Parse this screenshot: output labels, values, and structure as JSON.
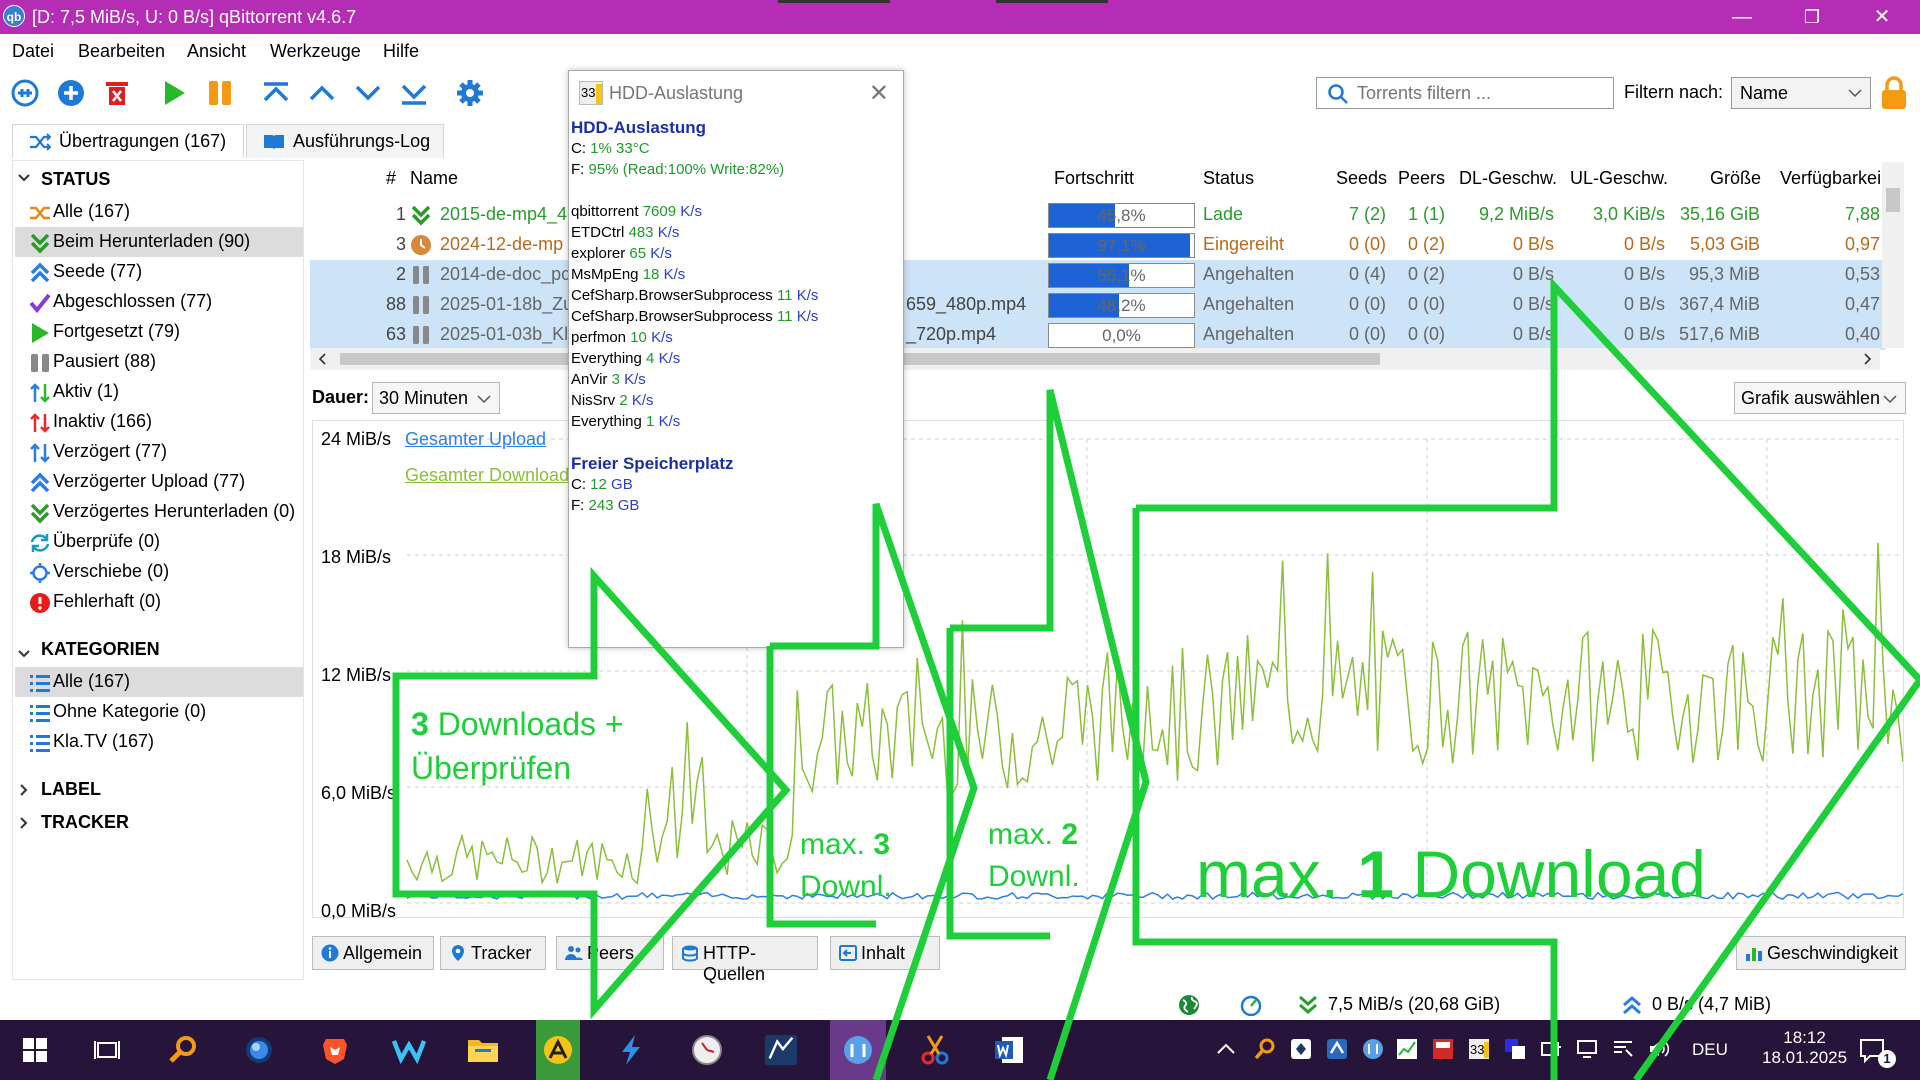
{
  "window": {
    "title": "[D: 7,5 MiB/s, U: 0 B/s] qBittorrent v4.6.7",
    "app_icon": "qb",
    "minimize": "—",
    "maximize": "❐",
    "close": "✕"
  },
  "menu": [
    "Datei",
    "Bearbeiten",
    "Ansicht",
    "Werkzeuge",
    "Hilfe"
  ],
  "toolbar": {
    "search_placeholder": "Torrents filtern ...",
    "filter_label": "Filtern nach:",
    "filter_value": "Name"
  },
  "tabs": [
    {
      "label": "Übertragungen (167)"
    },
    {
      "label": "Ausführungs-Log"
    }
  ],
  "sidebar": {
    "status_title": "STATUS",
    "status_items": [
      {
        "label": "Alle (167)",
        "color": "#e8861a"
      },
      {
        "label": "Beim Herunterladen (90)",
        "color": "#2a9a2a"
      },
      {
        "label": "Seede (77)",
        "color": "#2a7de8"
      },
      {
        "label": "Abgeschlossen (77)",
        "color": "#8a3ad6"
      },
      {
        "label": "Fortgesetzt (79)",
        "color": "#2ab82a"
      },
      {
        "label": "Pausiert (88)",
        "color": "#888888"
      },
      {
        "label": "Aktiv (1)",
        "color": "#2a7de8"
      },
      {
        "label": "Inaktiv (166)",
        "color": "#e82a2a"
      },
      {
        "label": "Verzögert (77)",
        "color": "#2a7de8"
      },
      {
        "label": "Verzögerter Upload (77)",
        "color": "#2a7de8"
      },
      {
        "label": "Verzögertes Herunterladen (0)",
        "color": "#2a9a2a"
      },
      {
        "label": "Überprüfe (0)",
        "color": "#1a9ac0"
      },
      {
        "label": "Verschiebe (0)",
        "color": "#2a7de8"
      },
      {
        "label": "Fehlerhaft (0)",
        "color": "#e82a2a"
      }
    ],
    "categories_title": "KATEGORIEN",
    "category_items": [
      {
        "label": "Alle (167)"
      },
      {
        "label": "Ohne Kategorie (0)"
      },
      {
        "label": "Kla.TV (167)"
      }
    ],
    "label_title": "LABEL",
    "tracker_title": "TRACKER"
  },
  "table": {
    "headers": {
      "num": "#",
      "name": "Name",
      "progress": "Fortschritt",
      "status": "Status",
      "seeds": "Seeds",
      "peers": "Peers",
      "dl": "DL-Geschw.",
      "ul": "UL-Geschw.",
      "size": "Größe",
      "avail": "Verfügbarkei"
    },
    "rows": [
      {
        "num": "1",
        "name": "2015-de-mp4_4",
        "name_tail": "",
        "progress": "45,8%",
        "progress_value": 0.458,
        "status": "Lade",
        "seeds": "7 (2)",
        "peers": "1 (1)",
        "dl": "9,2 MiB/s",
        "ul": "3,0 KiB/s",
        "size": "35,16 GiB",
        "avail": "7,88",
        "icon": "download"
      },
      {
        "num": "3",
        "name": "2024-12-de-mp",
        "name_tail": "",
        "progress": "97,1%",
        "progress_value": 0.971,
        "status": "Eingereiht",
        "seeds": "0 (0)",
        "peers": "0 (2)",
        "dl": "0 B/s",
        "ul": "0 B/s",
        "size": "5,03 GiB",
        "avail": "0,97",
        "icon": "queued"
      },
      {
        "num": "2",
        "name": "2014-de-doc_pc",
        "name_tail": "",
        "progress": "55,1%",
        "progress_value": 0.551,
        "status": "Angehalten",
        "seeds": "0 (4)",
        "peers": "0 (2)",
        "dl": "0 B/s",
        "ul": "0 B/s",
        "size": "95,3 MiB",
        "avail": "0,53",
        "icon": "paused"
      },
      {
        "num": "88",
        "name": "2025-01-18b_Zu",
        "name_tail": "659_480p.mp4",
        "progress": "48,2%",
        "progress_value": 0.482,
        "status": "Angehalten",
        "seeds": "0 (0)",
        "peers": "0 (0)",
        "dl": "0 B/s",
        "ul": "0 B/s",
        "size": "367,4 MiB",
        "avail": "0,47",
        "icon": "paused"
      },
      {
        "num": "63",
        "name": "2025-01-03b_Kl",
        "name_tail": "_720p.mp4",
        "progress": "0,0%",
        "progress_value": 0.0,
        "status": "Angehalten",
        "seeds": "0 (0)",
        "peers": "0 (0)",
        "dl": "0 B/s",
        "ul": "0 B/s",
        "size": "517,6 MiB",
        "avail": "0,40",
        "icon": "paused"
      }
    ]
  },
  "graph_controls": {
    "dauer_label": "Dauer:",
    "dauer_value": "30 Minuten",
    "grafik_value": "Grafik auswählen"
  },
  "graph": {
    "y_labels": [
      "24 MiB/s",
      "18 MiB/s",
      "12 MiB/s",
      "6,0 MiB/s",
      "0,0 MiB/s"
    ],
    "legend_upload": "Gesamter Upload",
    "legend_download": "Gesamter Download",
    "upload_color": "#2a80e8",
    "download_color": "#8cbf3a"
  },
  "bottom_tabs": [
    "Allgemein",
    "Tracker",
    "Peers",
    "HTTP-Quellen",
    "Inhalt",
    "Geschwindigkeit"
  ],
  "statusbar": {
    "download": "7,5 MiB/s (20,68 GiB)",
    "upload": "0 B/s (4,7 MiB)"
  },
  "taskbar": {
    "lang": "DEU",
    "time": "18:12",
    "date": "18.01.2025",
    "notification": "1"
  },
  "popup": {
    "title": "HDD-Auslastung",
    "icon_text": "33",
    "head1": "HDD-Auslastung",
    "c_label": "C:",
    "c_value": "1% 33°C",
    "f_label": "F:",
    "f_value": "95% (Read:100% Write:82%)",
    "processes": [
      {
        "name": "qbittorrent",
        "num": "7609",
        "unit": "K/s"
      },
      {
        "name": "ETDCtrl",
        "num": "483",
        "unit": "K/s"
      },
      {
        "name": "explorer",
        "num": "65",
        "unit": "K/s"
      },
      {
        "name": "MsMpEng",
        "num": "18",
        "unit": "K/s"
      },
      {
        "name": "CefSharp.BrowserSubprocess",
        "num": "11",
        "unit": "K/s"
      },
      {
        "name": "CefSharp.BrowserSubprocess",
        "num": "11",
        "unit": "K/s"
      },
      {
        "name": "perfmon",
        "num": "10",
        "unit": "K/s"
      },
      {
        "name": "Everything",
        "num": "4",
        "unit": "K/s"
      },
      {
        "name": "AnVir",
        "num": "3",
        "unit": "K/s"
      },
      {
        "name": "NisSrv",
        "num": "2",
        "unit": "K/s"
      },
      {
        "name": "Everything",
        "num": "1",
        "unit": "K/s"
      }
    ],
    "head2": "Freier Speicherplatz",
    "free_c_label": "C:",
    "free_c_num": "12",
    "free_c_unit": "GB",
    "free_f_label": "F:",
    "free_f_num": "243",
    "free_f_unit": "GB"
  },
  "annotations": {
    "a1_num": "3",
    "a1_rest": "Downloads +",
    "a1_line2": "Überprüfen",
    "a2_prefix": "max.",
    "a2_num": "3",
    "a2_line2": "Downl.",
    "a3_prefix": "max.",
    "a3_num": "2",
    "a3_line2": "Downl.",
    "a4_prefix": "max.",
    "a4_num": "1",
    "a4_rest": "Download",
    "color": "#1ecf3a"
  }
}
